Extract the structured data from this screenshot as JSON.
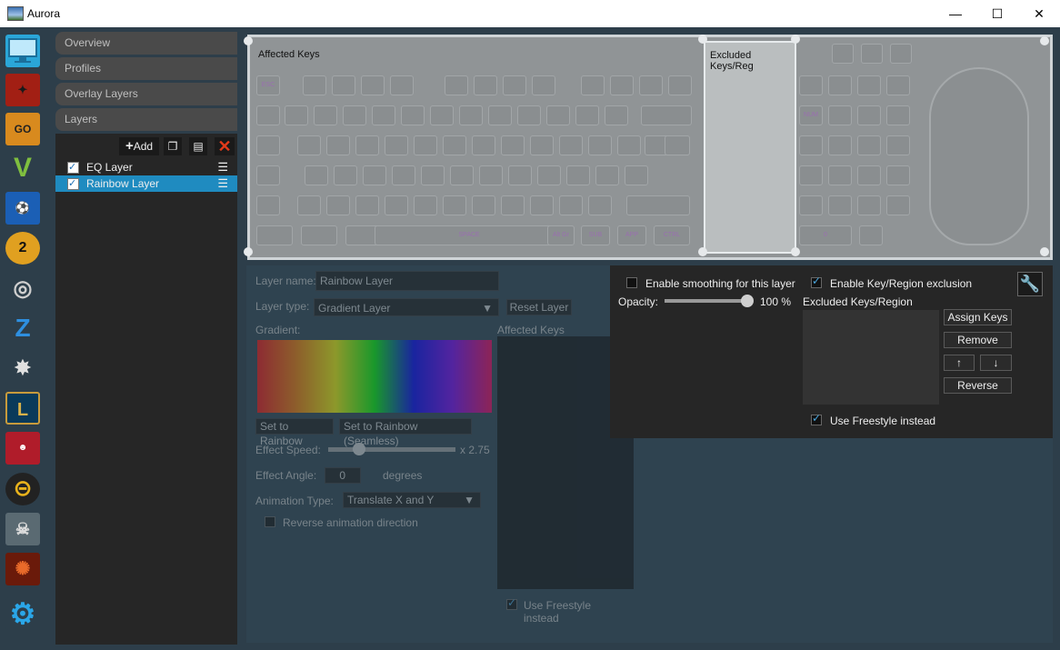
{
  "window": {
    "title": "Aurora",
    "minimize": "—",
    "maximize": "☐",
    "close": "✕"
  },
  "gamebar": {
    "items": [
      "desktop",
      "dota2",
      "csgo",
      "gta5",
      "rocket-league",
      "payday2",
      "overwatch",
      "dont-starve",
      "the-division",
      "league-of-legends",
      "hotline-miami",
      "osu",
      "battlefield",
      "doom",
      "settings"
    ]
  },
  "nav": {
    "items": [
      "Overview",
      "Profiles",
      "Overlay Layers",
      "Layers"
    ]
  },
  "layers": {
    "add_label": "Add",
    "items": [
      {
        "name": "EQ Layer",
        "selected": false
      },
      {
        "name": "Rainbow Layer",
        "selected": true
      }
    ]
  },
  "preview": {
    "affected_label": "Affected Keys",
    "excluded_label": "Excluded Keys/Reg",
    "key_labels": {
      "esc": "ESC",
      "space": "SPACE",
      "altgr": "Alt Gr",
      "fn": "SUB",
      "app": "APP",
      "ctrl": "CTRL",
      "numlock": "NUM",
      "zero": "0"
    }
  },
  "layer_editor": {
    "name_label": "Layer name:",
    "name_value": "Rainbow Layer",
    "type_label": "Layer type:",
    "type_value": "Gradient Layer",
    "reset_label": "Reset Layer",
    "gradient_label": "Gradient:",
    "affected_label": "Affected Keys",
    "set_rainbow": "Set to Rainbow",
    "set_rainbow_seamless": "Set to Rainbow (Seamless)",
    "speed_label": "Effect Speed:",
    "speed_value": "x 2.75",
    "angle_label": "Effect Angle:",
    "angle_value": "0",
    "angle_unit": "degrees",
    "anim_label": "Animation Type:",
    "anim_value": "Translate X and Y",
    "reverse_label": "Reverse animation direction",
    "freestyle_label": "Use Freestyle instead"
  },
  "right_panel": {
    "smoothing_label": "Enable smoothing for this layer",
    "exclusion_label": "Enable Key/Region exclusion",
    "opacity_label": "Opacity:",
    "opacity_value": "100 %",
    "excluded_label": "Excluded Keys/Region",
    "assign_keys": "Assign Keys",
    "remove": "Remove",
    "up": "↑",
    "down": "↓",
    "reverse": "Reverse",
    "freestyle_label": "Use Freestyle instead"
  }
}
